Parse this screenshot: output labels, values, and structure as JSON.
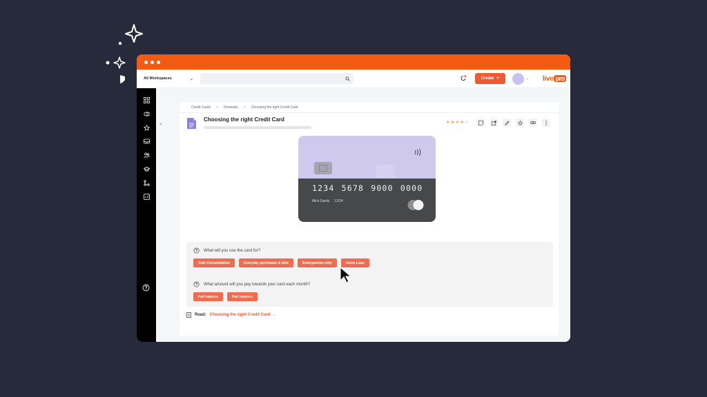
{
  "colors": {
    "accent": "#f35b12",
    "button": "#ef5a36",
    "option": "#ef6c50",
    "card_top": "#cfc9ee",
    "card_bottom": "#474849",
    "star": "#f0a05a",
    "background": "#262a3a"
  },
  "topbar": {
    "workspace_label": "All Workspaces",
    "search_placeholder": "",
    "create_label": "Create",
    "logo_live": "live",
    "logo_pro": "pro"
  },
  "breadcrumb": [
    "Credit Cards",
    "Domestic",
    "Choosing the right Credit Card"
  ],
  "article": {
    "title": "Choosing the right Credit Card",
    "rating": 4,
    "rating_max": 5
  },
  "card": {
    "number": "1234 5678 9000 0000",
    "holder": "Mick Gardy",
    "expiry": "12/24"
  },
  "quiz": {
    "q1": "What will you use the card for?",
    "q1_options": [
      "Debt Consolidation",
      "Everyday purchases & bills",
      "Emergencies only",
      "Home Loan"
    ],
    "q2": "What amount will you pay towards your card each month?",
    "q2_options": [
      "Full balance",
      "Part balance"
    ]
  },
  "read": {
    "label": "Read:",
    "link": "Choosing the right Credit Card →"
  },
  "sidebar_icons": [
    "grid-icon",
    "megaphone-icon",
    "star-icon",
    "inbox-icon",
    "users-icon",
    "graduation-cap-icon",
    "workflow-icon",
    "report-icon"
  ],
  "toolbar_icons": [
    "sticky-note-icon",
    "share-icon",
    "edit-icon",
    "favorite-icon",
    "link-icon",
    "more-icon"
  ]
}
